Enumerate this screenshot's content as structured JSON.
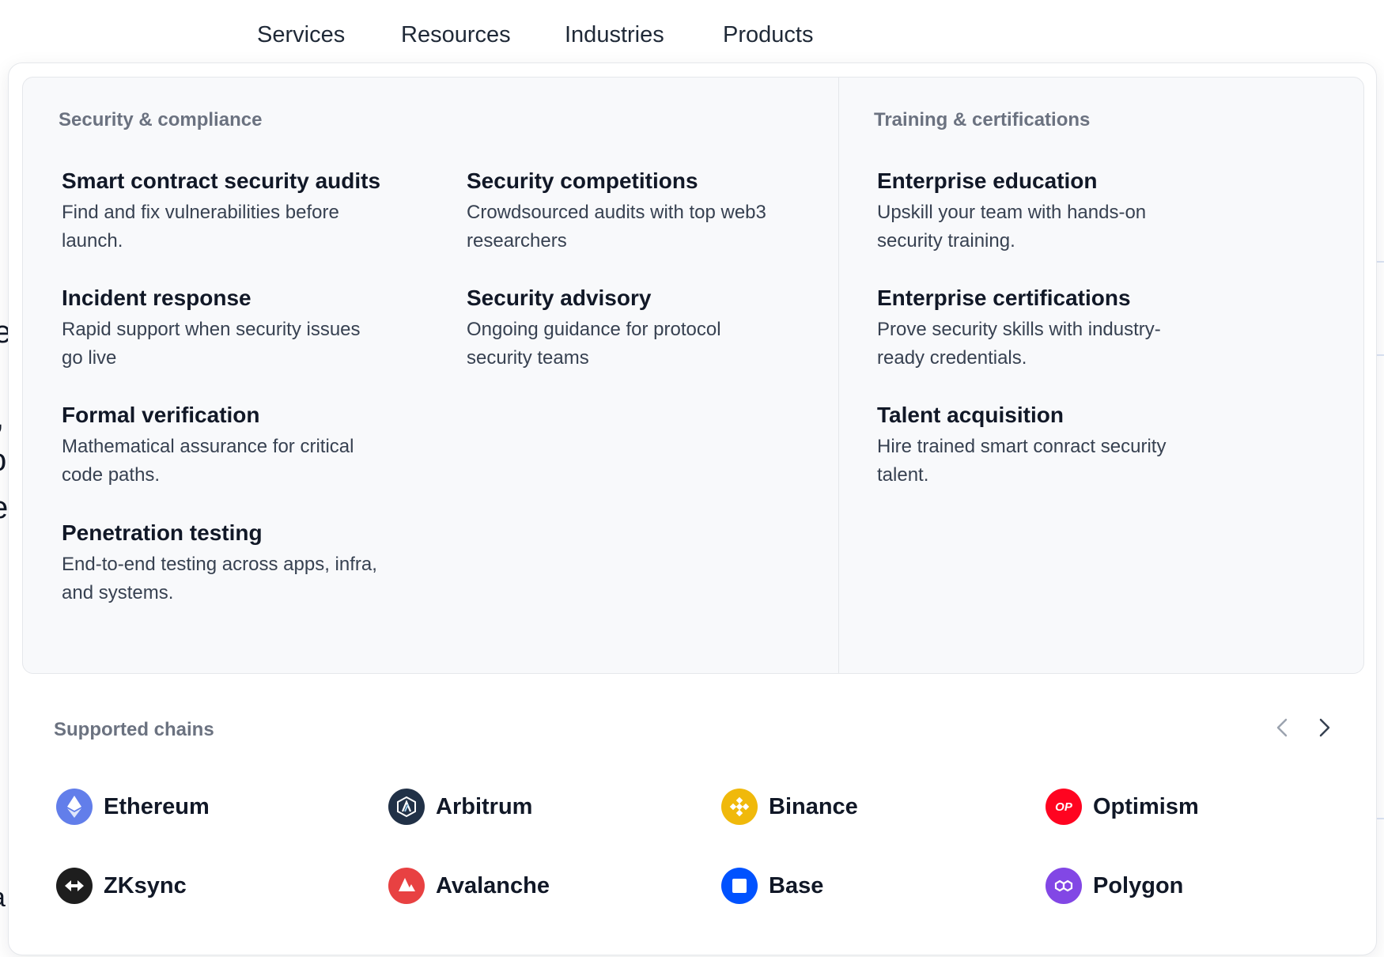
{
  "nav": {
    "items": [
      {
        "label": "Services"
      },
      {
        "label": "Resources"
      },
      {
        "label": "Industries"
      },
      {
        "label": "Products"
      }
    ]
  },
  "background": {
    "fragments": [
      "e",
      ",",
      "o",
      "e",
      "a"
    ]
  },
  "dropdown": {
    "security": {
      "label": "Security & compliance",
      "items": [
        {
          "title": "Smart contract security audits",
          "desc": "Find and fix vulnerabilities before launch."
        },
        {
          "title": "Incident response",
          "desc": "Rapid support when security issues go live"
        },
        {
          "title": "Formal verification",
          "desc": "Mathematical assurance for critical code paths."
        },
        {
          "title": "Penetration testing",
          "desc": "End-to-end testing across apps, infra, and systems."
        },
        {
          "title": "Security competitions",
          "desc": "Crowdsourced audits with top web3 researchers"
        },
        {
          "title": "Security advisory",
          "desc": "Ongoing guidance for protocol security teams"
        }
      ]
    },
    "training": {
      "label": "Training & certifications",
      "items": [
        {
          "title": "Enterprise education",
          "desc": "Upskill your team with hands-on security training."
        },
        {
          "title": "Enterprise certifications",
          "desc": "Prove security skills with industry-ready credentials."
        },
        {
          "title": "Talent acquisition",
          "desc": "Hire trained smart conract security talent."
        }
      ]
    },
    "chains": {
      "label": "Supported chains",
      "items": [
        {
          "name": "Ethereum",
          "icon": "ethereum-icon",
          "color": "#627eea"
        },
        {
          "name": "Arbitrum",
          "icon": "arbitrum-icon",
          "color": "#213147"
        },
        {
          "name": "Binance",
          "icon": "binance-icon",
          "color": "#f0b90b"
        },
        {
          "name": "Optimism",
          "icon": "optimism-icon",
          "color": "#ff0420",
          "glyph": "OP"
        },
        {
          "name": "ZKsync",
          "icon": "zksync-icon",
          "color": "#1e1e1e"
        },
        {
          "name": "Avalanche",
          "icon": "avalanche-icon",
          "color": "#e84142"
        },
        {
          "name": "Base",
          "icon": "base-icon",
          "color": "#0052ff"
        },
        {
          "name": "Polygon",
          "icon": "polygon-icon",
          "color": "#8247e5"
        }
      ]
    }
  }
}
